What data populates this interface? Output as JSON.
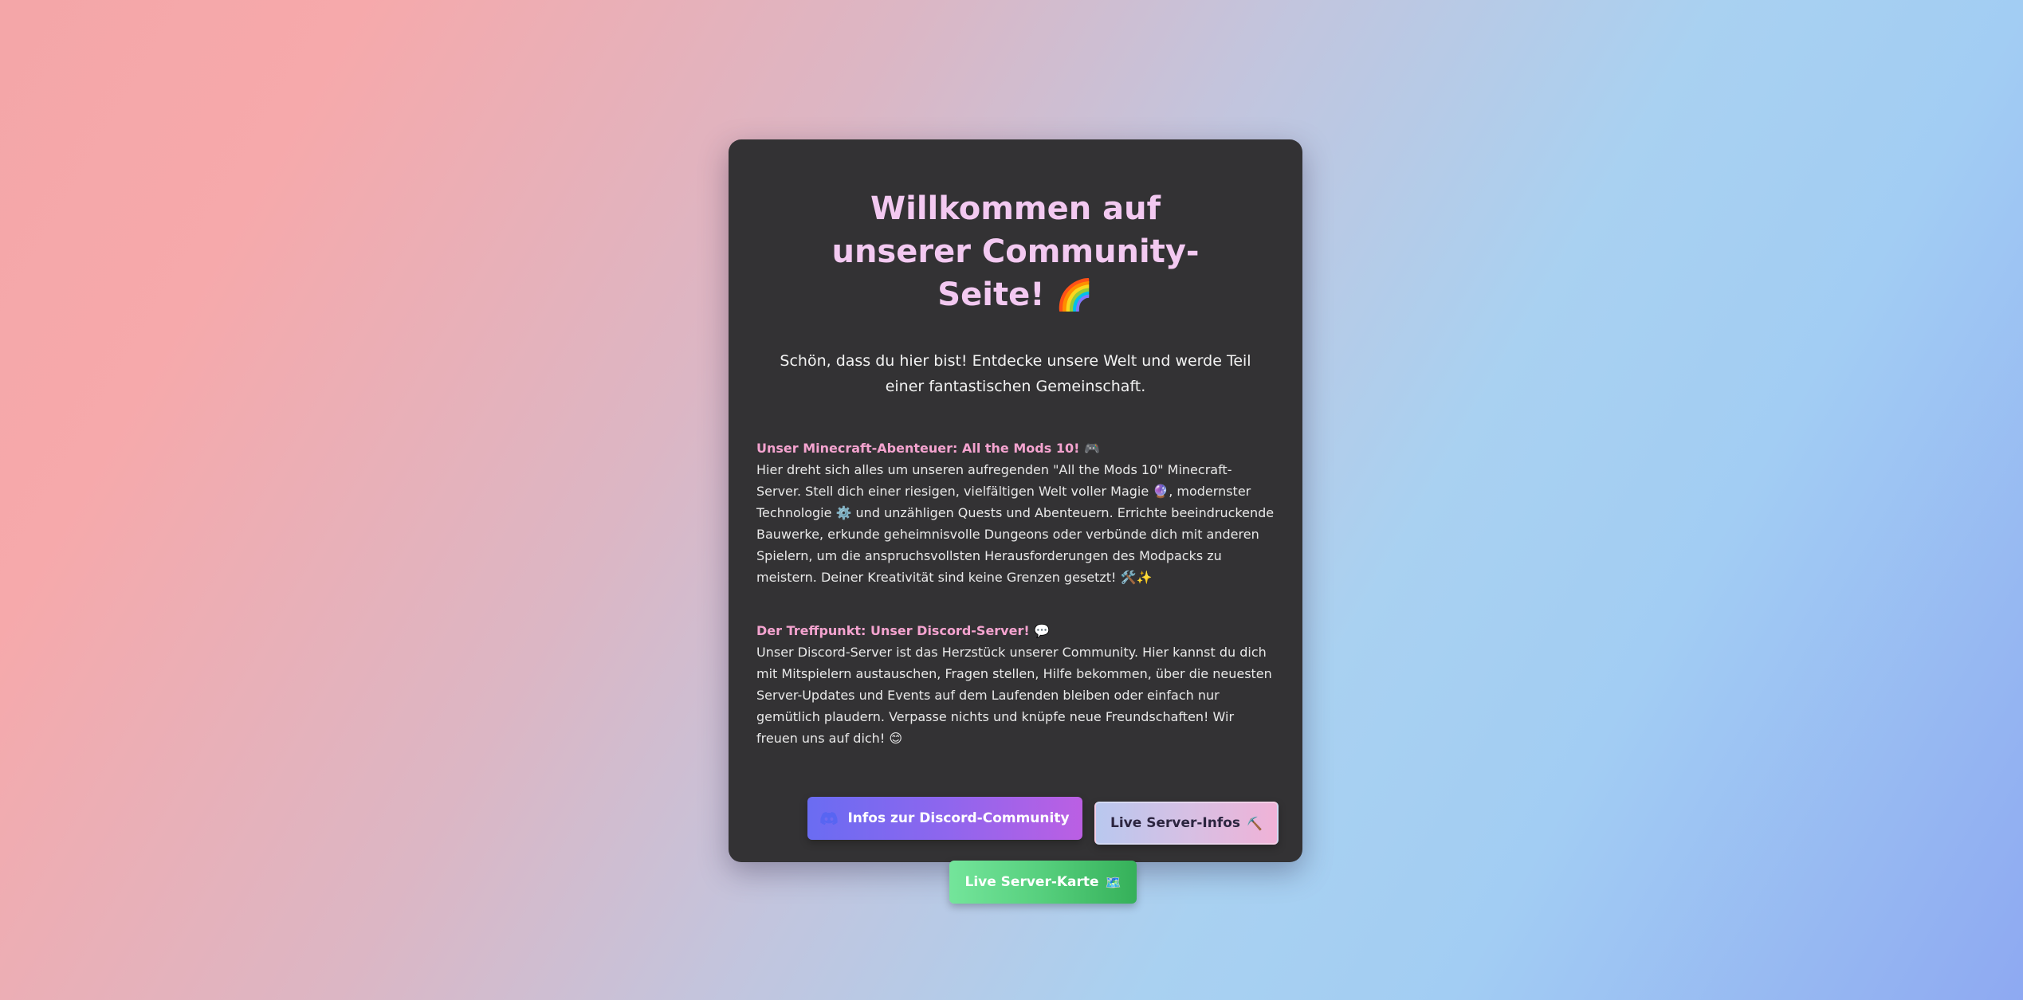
{
  "card": {
    "title": "Willkommen auf unserer Community-Seite!",
    "title_emoji": "🌈",
    "lead": "Schön, dass du hier bist! Entdecke unsere Welt und werde Teil einer fantastischen Gemeinschaft."
  },
  "sections": [
    {
      "title": "Unser Minecraft-Abenteuer: All the Mods 10! 🎮",
      "text": "Hier dreht sich alles um unseren aufregenden \"All the Mods 10\" Minecraft-Server. Stell dich einer riesigen, vielfältigen Welt voller Magie 🔮, modernster Technologie ⚙️ und unzähligen Quests und Abenteuern. Errichte beeindruckende Bauwerke, erkunde geheimnisvolle Dungeons oder verbünde dich mit anderen Spielern, um die anspruchsvollsten Herausforderungen des Modpacks zu meistern. Deiner Kreativität sind keine Grenzen gesetzt! 🛠️✨"
    },
    {
      "title": "Der Treffpunkt: Unser Discord-Server! 💬",
      "text": "Unser Discord-Server ist das Herzstück unserer Community. Hier kannst du dich mit Mitspielern austauschen, Fragen stellen, Hilfe bekommen, über die neuesten Server-Updates und Events auf dem Laufenden bleiben oder einfach nur gemütlich plaudern. Verpasse nichts und knüpfe neue Freundschaften! Wir freuen uns auf dich! 😊"
    }
  ],
  "buttons": {
    "discord_label": "Infos zur Discord-Community",
    "discord_icon": "discord-icon",
    "server_info_label": "Live Server-Infos",
    "server_info_icon": "⛏️",
    "server_map_label": "Live Server-Karte",
    "server_map_icon": "🗺️"
  },
  "colors": {
    "card_background": "#333234",
    "title": "#f3c9f1",
    "section_title": "#f4a3cf",
    "discord_button": "#8e66ee",
    "server_info_button": "#d6c0e4",
    "server_map_button": "#56cf7d"
  }
}
